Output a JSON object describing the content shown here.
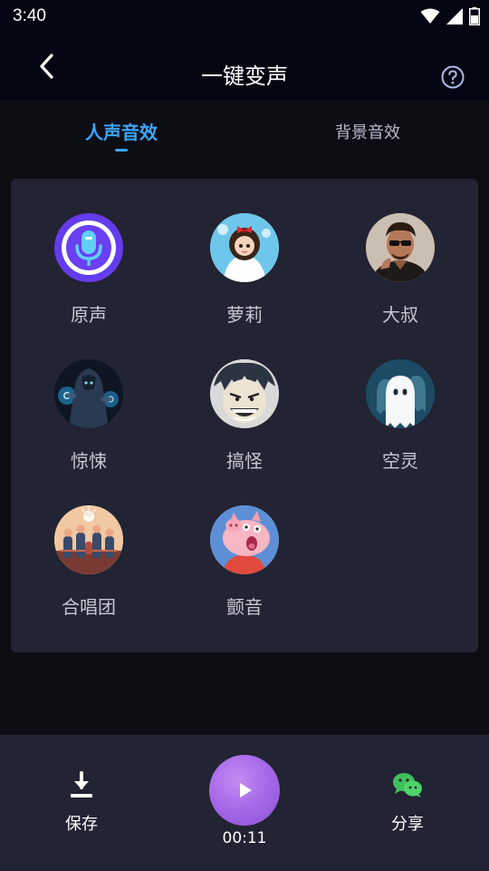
{
  "status_bar": {
    "time": "3:40"
  },
  "header": {
    "title": "一键变声"
  },
  "tabs": [
    {
      "label": "人声音效",
      "active": true
    },
    {
      "label": "背景音效",
      "active": false
    }
  ],
  "effects": [
    {
      "label": "原声",
      "icon": "microphone-icon"
    },
    {
      "label": "萝莉",
      "icon": "girl-avatar"
    },
    {
      "label": "大叔",
      "icon": "man-avatar"
    },
    {
      "label": "惊悚",
      "icon": "thriller-avatar"
    },
    {
      "label": "搞怪",
      "icon": "funny-avatar"
    },
    {
      "label": "空灵",
      "icon": "ghost-avatar"
    },
    {
      "label": "合唱团",
      "icon": "choir-avatar"
    },
    {
      "label": "颤音",
      "icon": "pig-avatar"
    }
  ],
  "bottom_bar": {
    "save_label": "保存",
    "share_label": "分享",
    "duration": "00:11"
  },
  "colors": {
    "accent": "#3aa6ff",
    "panel": "#222333",
    "play": "#a76be8"
  }
}
